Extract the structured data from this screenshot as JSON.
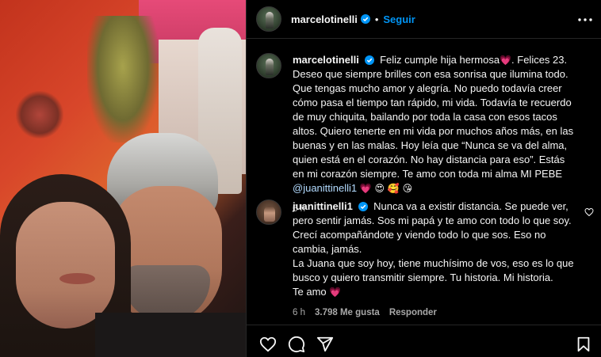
{
  "post": {
    "author": "marcelotinelli",
    "separator": "•",
    "follow_label": "Seguir"
  },
  "caption": {
    "username": "marcelotinelli",
    "text": "Feliz cumple hija hermosa",
    "text2": ". Felices 23. Deseo que siempre brilles con esa sonrisa que ilumina todo. Que tengas mucho amor y alegría. No puedo todavía creer cómo pasa el tiempo tan rápido, mi vida. Todavía te recuerdo de muy chiquita, bailando por toda la casa con esos tacos altos. Quiero tenerte en mi vida por muchos años más, en las buenas y en las malas. Hoy leía que “Nunca se va del alma, quien está en el corazón. No hay distancia para eso”. Estás en mi corazón siempre. Te amo con toda mi alma MI PEBE ",
    "mention": "@juanittinelli1",
    "emojis": "💗 😍 🥰 😘",
    "heart": "💗",
    "time": "6 h"
  },
  "reply": {
    "username": "juanittinelli1",
    "lines": [
      "Nunca va a existir distancia. Se puede ver, pero sentir jamás. Sos mi papá y te amo con todo lo que soy.",
      "Crecí acompañándote y viendo todo lo que sos. Eso no cambia, jamás.",
      "La Juana que soy hoy, tiene muchísimo de vos, eso es lo que busco y quiero transmitir siempre. Tu historia. Mi historia.",
      "Te amo"
    ],
    "heart": "💗",
    "time": "6 h",
    "likes": "3.798 Me gusta",
    "reply_label": "Responder"
  },
  "colors": {
    "link": "#0095f6",
    "verified": "#0095f6",
    "muted": "#a8a8a8"
  },
  "icons": [
    "more-icon",
    "verified-icon",
    "like-icon",
    "comment-icon",
    "share-icon",
    "save-icon",
    "small-heart-icon"
  ]
}
